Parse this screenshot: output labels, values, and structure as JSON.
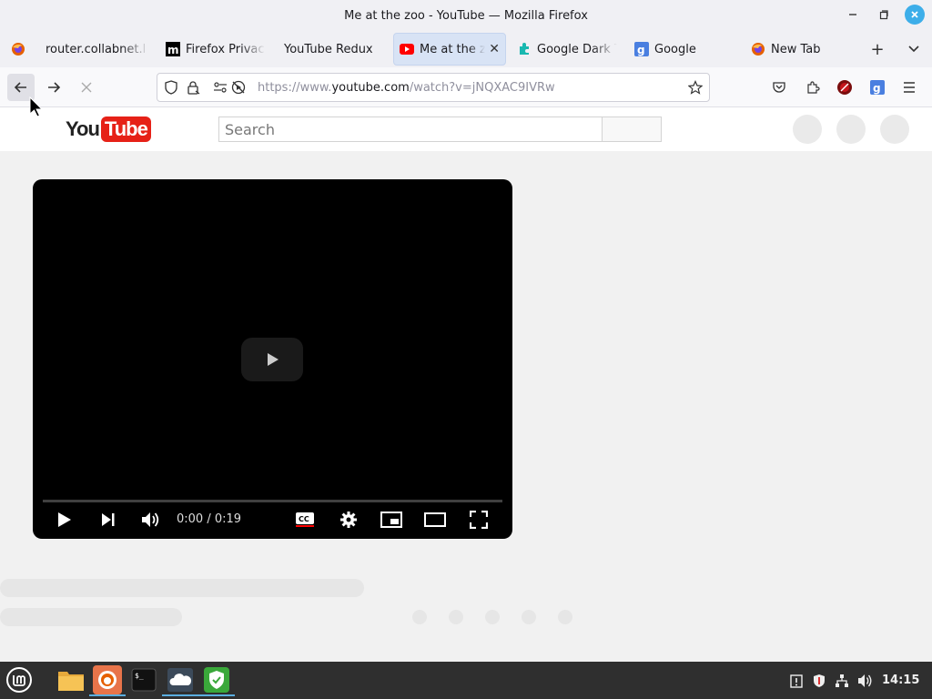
{
  "window": {
    "title": "Me at the zoo - YouTube — Mozilla Firefox"
  },
  "tabs": [
    {
      "label": "router.collabnet.l",
      "icon": "collabnet-icon"
    },
    {
      "label": "Firefox Privac",
      "icon": "mozilla-m-icon"
    },
    {
      "label": "YouTube Redux",
      "icon": "none"
    },
    {
      "label": "Me at the zo",
      "icon": "youtube-icon",
      "active": true
    },
    {
      "label": "Google Dark T",
      "icon": "puzzle-icon"
    },
    {
      "label": "Google",
      "icon": "google-g-icon"
    },
    {
      "label": "New Tab",
      "icon": "firefox-icon"
    }
  ],
  "urlbar": {
    "prefix": "https://www.",
    "host": "youtube.com",
    "path": "/watch?v=jNQXAC9IVRw"
  },
  "youtube": {
    "logo_you": "You",
    "logo_tube": "Tube",
    "search_placeholder": "Search"
  },
  "player": {
    "time": "0:00 / 0:19",
    "progress_fraction": 0.0
  },
  "taskbar": {
    "clock": "14:15"
  },
  "colors": {
    "youtube_red": "#e62117",
    "accent": "#3daee9",
    "active_tab": "#d8e3f5"
  }
}
